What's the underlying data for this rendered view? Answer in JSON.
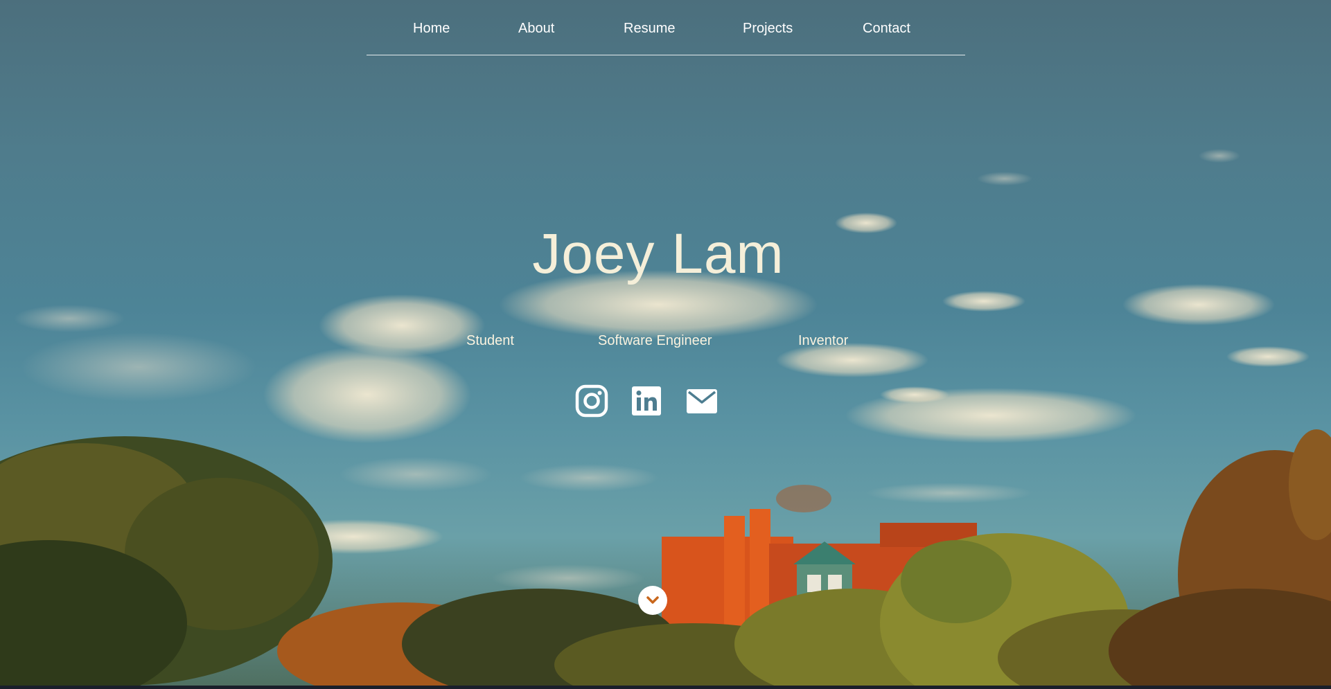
{
  "nav": {
    "items": [
      {
        "label": "Home"
      },
      {
        "label": "About"
      },
      {
        "label": "Resume"
      },
      {
        "label": "Projects"
      },
      {
        "label": "Contact"
      }
    ]
  },
  "hero": {
    "name": "Joey Lam",
    "roles": [
      "Student",
      "Software Engineer",
      "Inventor"
    ],
    "social_icons": [
      "instagram-icon",
      "linkedin-icon",
      "mail-icon"
    ],
    "scroll_icon": "chevron-down-icon"
  },
  "colors": {
    "title": "#f5efd9",
    "nav_text": "#ffffff",
    "sky": "#4d8497",
    "scroll_chevron": "#c8661b"
  }
}
